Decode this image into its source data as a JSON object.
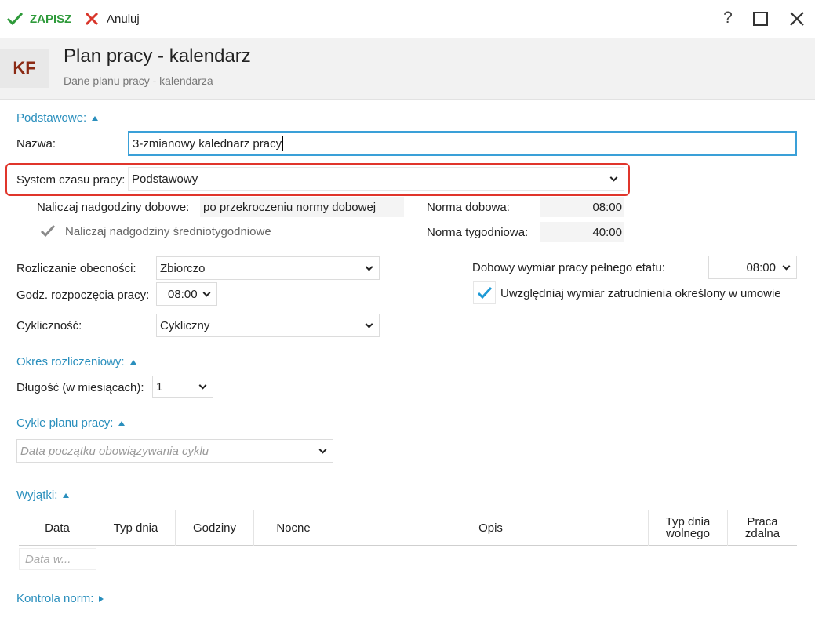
{
  "toolbar": {
    "save_label": "ZAPISZ",
    "cancel_label": "Anuluj",
    "help_label": "?"
  },
  "header": {
    "avatar": "KF",
    "title": "Plan pracy - kalendarz",
    "subtitle": "Dane planu pracy - kalendarza"
  },
  "basic": {
    "section_label": "Podstawowe:",
    "name_label": "Nazwa:",
    "name_value": "3-zmianowy kalednarz pracy",
    "system_label": "System czasu pracy:",
    "system_value": "Podstawowy",
    "overtime_daily_label": "Naliczaj nadgodziny dobowe:",
    "overtime_daily_value": "po przekroczeniu normy dobowej",
    "overtime_weekly_label": "Naliczaj nadgodziny średniotygodniowe",
    "overtime_weekly_checked": true,
    "norm_daily_label": "Norma dobowa:",
    "norm_daily_value": "08:00",
    "norm_weekly_label": "Norma tygodniowa:",
    "norm_weekly_value": "40:00",
    "attendance_label": "Rozliczanie obecności:",
    "attendance_value": "Zbiorczo",
    "start_hour_label": "Godz. rozpoczęcia pracy:",
    "start_hour_value": "08:00",
    "cyclic_label": "Cykliczność:",
    "cyclic_value": "Cykliczny",
    "fulltime_label": "Dobowy wymiar pracy pełnego etatu:",
    "fulltime_value": "08:00",
    "include_contract_label": "Uwzględniaj wymiar zatrudnienia określony w umowie",
    "include_contract_checked": true
  },
  "period": {
    "section_label": "Okres rozliczeniowy:",
    "length_label": "Długość (w miesiącach):",
    "length_value": "1"
  },
  "cycles": {
    "section_label": "Cykle planu pracy:",
    "date_placeholder": "Data początku obowiązywania cyklu"
  },
  "exceptions": {
    "section_label": "Wyjątki:",
    "columns": [
      "Data",
      "Typ dnia",
      "Godziny",
      "Nocne",
      "Opis",
      "Typ dnia wolnego",
      "Praca zdalna"
    ],
    "date_placeholder": "Data w..."
  },
  "norms": {
    "section_label": "Kontrola norm:"
  },
  "colors": {
    "accent": "#2a8fbd",
    "save_green": "#2e9a3a",
    "cancel_red": "#d9362b",
    "highlight_red": "#e0352b",
    "check_blue": "#1f9ad6"
  }
}
